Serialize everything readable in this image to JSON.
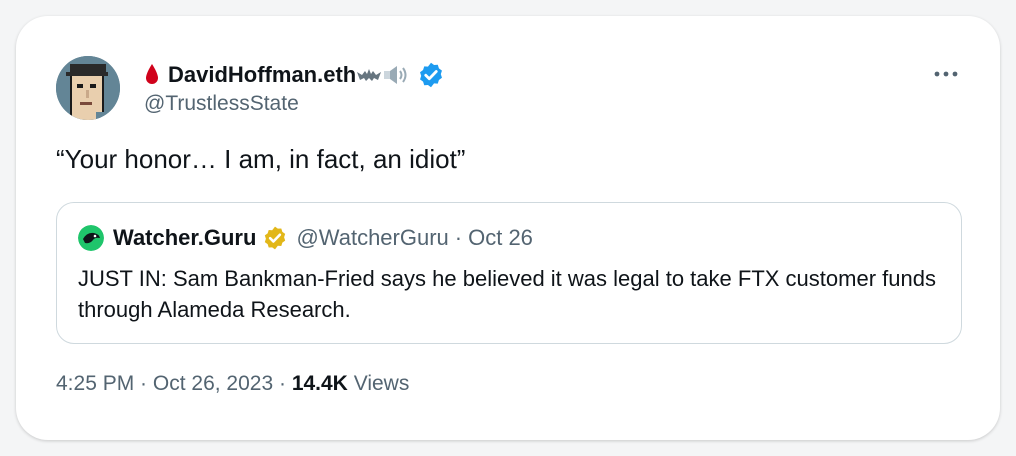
{
  "author": {
    "display_name": "DavidHoffman.eth",
    "handle": "@TrustlessState",
    "verified": true,
    "avatar": "pixel-punk-avatar",
    "name_icons": [
      "blood-drop-icon",
      "bat-icon",
      "speaker-icon"
    ]
  },
  "tweet": {
    "text": "“Your honor… I am, in fact, an idiot”"
  },
  "quoted_tweet": {
    "display_name": "Watcher.Guru",
    "handle": "@WatcherGuru",
    "separator": "·",
    "date": "Oct 26",
    "verified": "gold",
    "text": "JUST IN: Sam Bankman-Fried says he believed it was legal to take FTX customer funds through Alameda Research."
  },
  "meta": {
    "time": "4:25 PM",
    "separator_1": " · ",
    "date": "Oct 26, 2023",
    "separator_2": " · ",
    "views_count": "14.4K",
    "views_label": " Views"
  },
  "colors": {
    "text": "#0f1419",
    "secondary": "#536471",
    "border": "#cfd9de",
    "verified_blue": "#1d9bf0",
    "verified_gold": "#e2b719",
    "watcher_green": "#1fc56b",
    "drop_red": "#d0021b"
  }
}
